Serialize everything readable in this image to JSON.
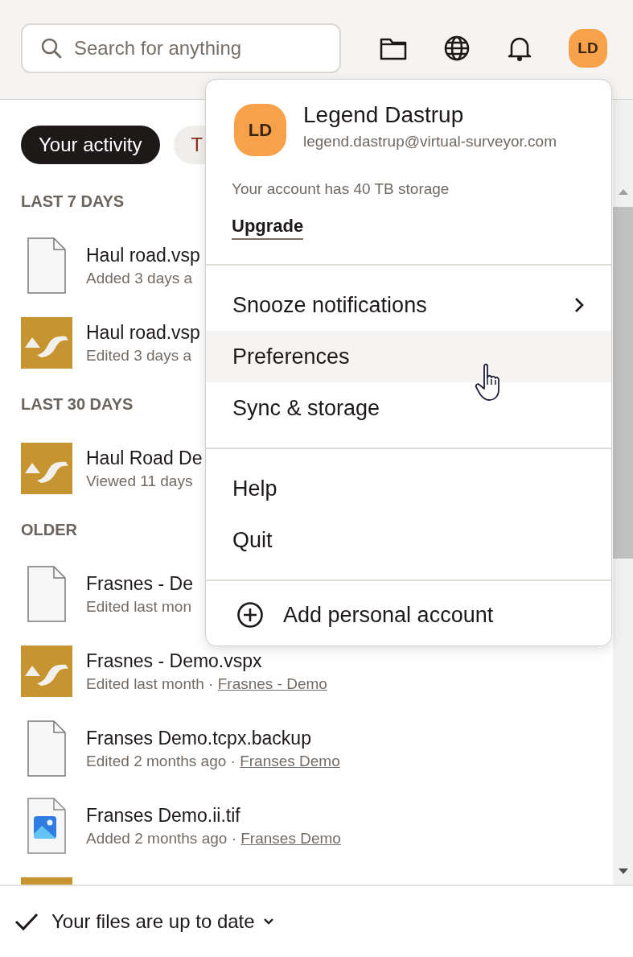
{
  "search": {
    "placeholder": "Search for anything"
  },
  "header_avatar": {
    "initials": "LD"
  },
  "tabs": [
    {
      "label": "Your activity",
      "selected": true
    },
    {
      "label": "T",
      "selected": false
    }
  ],
  "sections": [
    {
      "title": "LAST 7 DAYS",
      "files": [
        {
          "kind": "document",
          "name": "Haul road.vsp",
          "detail": "Added 3 days a"
        },
        {
          "kind": "app",
          "name": "Haul road.vsp",
          "detail": "Edited 3 days a"
        }
      ]
    },
    {
      "title": "LAST 30 DAYS",
      "files": [
        {
          "kind": "app",
          "name": "Haul Road De",
          "detail": "Viewed 11 days"
        }
      ]
    },
    {
      "title": "OLDER",
      "files": [
        {
          "kind": "document",
          "name": "Frasnes - De",
          "detail": "Edited last mon"
        },
        {
          "kind": "app",
          "name": "Frasnes - Demo.vspx",
          "detail": "Edited last month · ",
          "folder": "Frasnes - Demo"
        },
        {
          "kind": "document",
          "name": "Franses Demo.tcpx.backup",
          "detail": "Edited 2 months ago · ",
          "folder": "Franses Demo"
        },
        {
          "kind": "image",
          "name": "Franses Demo.ii.tif",
          "detail": "Added 2 months ago · ",
          "folder": "Franses Demo"
        },
        {
          "kind": "app"
        }
      ]
    }
  ],
  "account_menu": {
    "initials": "LD",
    "name": "Legend Dastrup",
    "email": "legend.dastrup@virtual-surveyor.com",
    "storage": "Your account has 40 TB storage",
    "upgrade": "Upgrade",
    "groups": [
      [
        {
          "label": "Snooze notifications",
          "submenu": true,
          "selected": false
        },
        {
          "label": "Preferences",
          "submenu": false,
          "selected": true
        },
        {
          "label": "Sync & storage",
          "submenu": false,
          "selected": false
        }
      ],
      [
        {
          "label": "Help",
          "submenu": false,
          "selected": false
        },
        {
          "label": "Quit",
          "submenu": false,
          "selected": false
        }
      ],
      [
        {
          "label": "Add personal account",
          "submenu": false,
          "selected": false,
          "kind": "add"
        }
      ]
    ]
  },
  "status": {
    "text": "Your files are up to date"
  }
}
